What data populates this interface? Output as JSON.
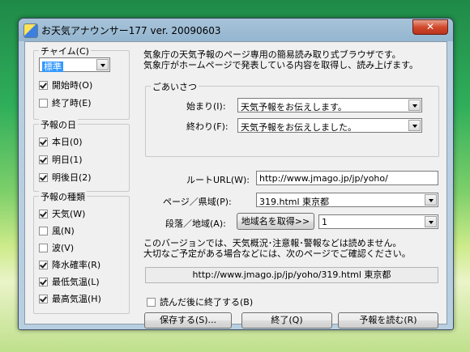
{
  "window": {
    "title": "お天気アナウンサー177 ver. 20090603",
    "close_label": "✕"
  },
  "chime": {
    "legend": "チャイム(C)",
    "selected": "標準",
    "start_label": "開始時(O)",
    "start_checked": true,
    "end_label": "終了時(E)",
    "end_checked": false
  },
  "days": {
    "legend": "予報の日",
    "items": [
      {
        "label": "本日(0)",
        "checked": true
      },
      {
        "label": "明日(1)",
        "checked": true
      },
      {
        "label": "明後日(2)",
        "checked": true
      }
    ]
  },
  "types": {
    "legend": "予報の種類",
    "items": [
      {
        "label": "天気(W)",
        "checked": true
      },
      {
        "label": "風(N)",
        "checked": false
      },
      {
        "label": "波(V)",
        "checked": false
      },
      {
        "label": "降水確率(R)",
        "checked": true
      },
      {
        "label": "最低気温(L)",
        "checked": true
      },
      {
        "label": "最高気温(H)",
        "checked": true
      }
    ]
  },
  "description": {
    "line1": "気象庁の天気予報のページ専用の簡易読み取り式ブラウザです。",
    "line2": "気象庁がホームページで発表している内容を取得し、読み上げます。"
  },
  "greeting": {
    "legend": "ごあいさつ",
    "start_label": "始まり(I):",
    "start_value": "天気予報をお伝えします。",
    "end_label": "終わり(F):",
    "end_value": "天気予報をお伝えしました。"
  },
  "url": {
    "label": "ルートURL(W):",
    "value": "http://www.jmago.jp/jp/yoho/"
  },
  "page": {
    "label": "ページ／県域(P):",
    "value": "319.html 東京都"
  },
  "section": {
    "label": "段落／地域(A):",
    "fetch_button": "地域名を取得>>",
    "value": "1"
  },
  "notice": {
    "line1": "このバージョンでは、天気概況･注意報･警報などは読めません。",
    "line2": "大切なご予定がある場合などには、次のページでご確認ください。"
  },
  "full_url": "http://www.jmago.jp/jp/yoho/319.html 東京都",
  "exit_after": {
    "label": "読んだ後に終了する(B)",
    "checked": false
  },
  "buttons": {
    "save": "保存する(S)...",
    "exit": "終了(Q)",
    "read": "予報を読む(R)"
  }
}
